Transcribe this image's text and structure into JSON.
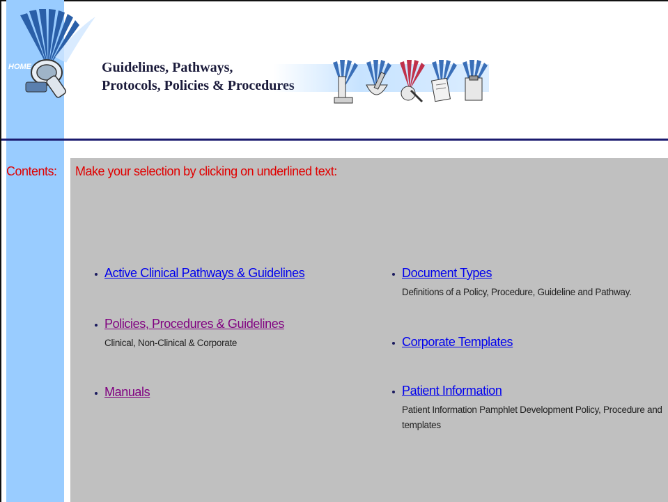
{
  "header": {
    "home_label": "HOME",
    "title_line1": "Guidelines, Pathways,",
    "title_line2": "Protocols, Policies & Procedures",
    "banner_icons": [
      "microscope-icon",
      "mortar-pestle-icon",
      "stethoscope-icon",
      "notepad-icon",
      "clipboard-icon"
    ]
  },
  "contents_label": "Contents:",
  "instruction": "Make your selection by clicking on underlined text:",
  "left_column": [
    {
      "label": "Active Clinical Pathways & Guidelines",
      "description": ""
    },
    {
      "label": "Policies, Procedures & Guidelines",
      "description": "Clinical, Non-Clinical & Corporate"
    },
    {
      "label": "Manuals",
      "description": ""
    }
  ],
  "right_column": [
    {
      "label": "Document Types",
      "description": "Definitions of a Policy, Procedure, Guideline and Pathway."
    },
    {
      "label": "Corporate Templates",
      "description": ""
    },
    {
      "label": "Patient Information",
      "description": "Patient Information Pamphlet Development Policy, Procedure and templates"
    }
  ],
  "colors": {
    "stripe": "#99ccff",
    "panel": "#c0c0c0",
    "accent_red": "#e00000",
    "link_blue": "#0000ee",
    "link_visited": "#800080",
    "rule": "#1a1a6e"
  }
}
